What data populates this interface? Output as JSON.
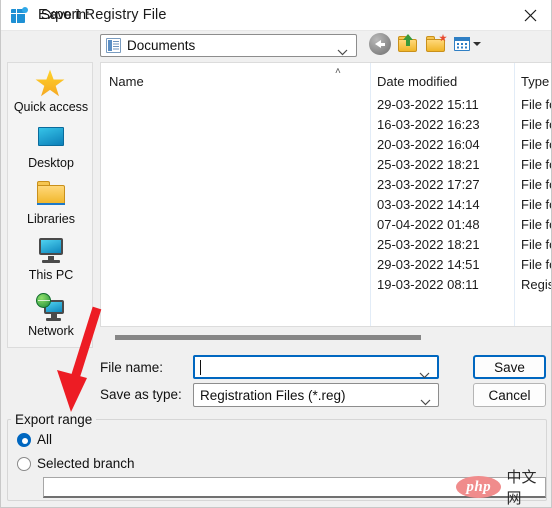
{
  "window": {
    "title": "Export Registry File",
    "icon": "registry-editor-icon",
    "close_label": "✕"
  },
  "toolbar": {
    "save_in_label": "Save in:",
    "location": "Documents",
    "buttons": [
      {
        "name": "back-button",
        "icon": "back-arrow-icon"
      },
      {
        "name": "up-folder-button",
        "icon": "up-one-level-icon"
      },
      {
        "name": "new-folder-button",
        "icon": "create-new-folder-icon"
      },
      {
        "name": "views-button",
        "icon": "views-grid-icon"
      }
    ]
  },
  "places_bar": {
    "items": [
      {
        "label": "Quick access",
        "icon": "star-icon"
      },
      {
        "label": "Desktop",
        "icon": "desktop-icon"
      },
      {
        "label": "Libraries",
        "icon": "libraries-folder-icon"
      },
      {
        "label": "This PC",
        "icon": "this-pc-monitor-icon"
      },
      {
        "label": "Network",
        "icon": "network-globe-icon"
      }
    ]
  },
  "file_list": {
    "columns": [
      "Name",
      "Date modified",
      "Type"
    ],
    "sort_indicator": "˄",
    "rows": [
      {
        "name": "",
        "date_modified": "29-03-2022 15:11",
        "type": "File fo"
      },
      {
        "name": "",
        "date_modified": "16-03-2022 16:23",
        "type": "File fo"
      },
      {
        "name": "",
        "date_modified": "20-03-2022 16:04",
        "type": "File fo"
      },
      {
        "name": "",
        "date_modified": "25-03-2022 18:21",
        "type": "File fo"
      },
      {
        "name": "",
        "date_modified": "23-03-2022 17:27",
        "type": "File fo"
      },
      {
        "name": "",
        "date_modified": "03-03-2022 14:14",
        "type": "File fo"
      },
      {
        "name": "",
        "date_modified": "07-04-2022 01:48",
        "type": "File fo"
      },
      {
        "name": "",
        "date_modified": "25-03-2022 18:21",
        "type": "File fo"
      },
      {
        "name": "",
        "date_modified": "29-03-2022 14:51",
        "type": "File fo"
      },
      {
        "name": "",
        "date_modified": "19-03-2022 08:11",
        "type": "Regis"
      }
    ]
  },
  "form": {
    "file_name_label": "File name:",
    "file_name_value": "",
    "save_as_type_label": "Save as type:",
    "save_as_type_value": "Registration Files (*.reg)",
    "save_button": "Save",
    "cancel_button": "Cancel"
  },
  "export_range": {
    "group_title": "Export range",
    "options": [
      {
        "label": "All",
        "selected": true
      },
      {
        "label": "Selected branch",
        "selected": false
      }
    ],
    "branch_value": ""
  },
  "watermark": {
    "logo_text": "php",
    "site_text": "中文网"
  },
  "colors": {
    "accent": "#0067c0",
    "annotation_arrow": "#ed1c24",
    "titlebar": "#ffffff",
    "dialog_bg": "#f0f0f0"
  }
}
